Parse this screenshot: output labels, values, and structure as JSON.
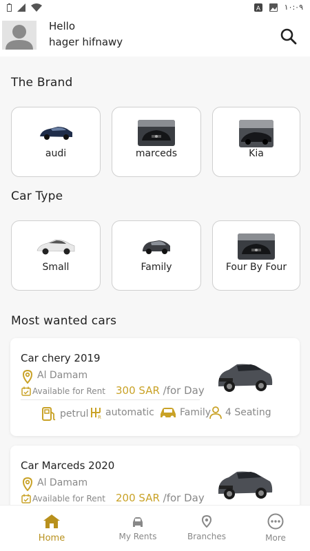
{
  "status_bar": {
    "time": "١٠:٠٩"
  },
  "header": {
    "hello": "Hello",
    "username": "hager hifnawy"
  },
  "brands": {
    "title": "The Brand",
    "items": [
      {
        "label": "audi"
      },
      {
        "label": "marceds"
      },
      {
        "label": "Kia"
      }
    ]
  },
  "car_types": {
    "title": "Car Type",
    "items": [
      {
        "label": "Small"
      },
      {
        "label": "Family"
      },
      {
        "label": "Four By Four"
      }
    ]
  },
  "most_wanted": {
    "title": "Most wanted cars",
    "cars": [
      {
        "name": "Car chery 2019",
        "location": "Al Damam",
        "availability": "Available for Rent",
        "price": "300 SAR",
        "per": "/for Day",
        "fuel": "petrul",
        "transmission": "automatic",
        "type": "Family",
        "seating": "4 Seating"
      },
      {
        "name": "Car Marceds 2020",
        "location": "Al Damam",
        "availability": "Available for Rent",
        "price": "200 SAR",
        "per": "/for Day"
      }
    ]
  },
  "bottom_nav": {
    "items": [
      {
        "label": "Home"
      },
      {
        "label": "My Rents"
      },
      {
        "label": "Branches"
      },
      {
        "label": "More"
      }
    ]
  },
  "colors": {
    "accent": "#c9a227",
    "text": "#222222",
    "muted": "#888888"
  }
}
